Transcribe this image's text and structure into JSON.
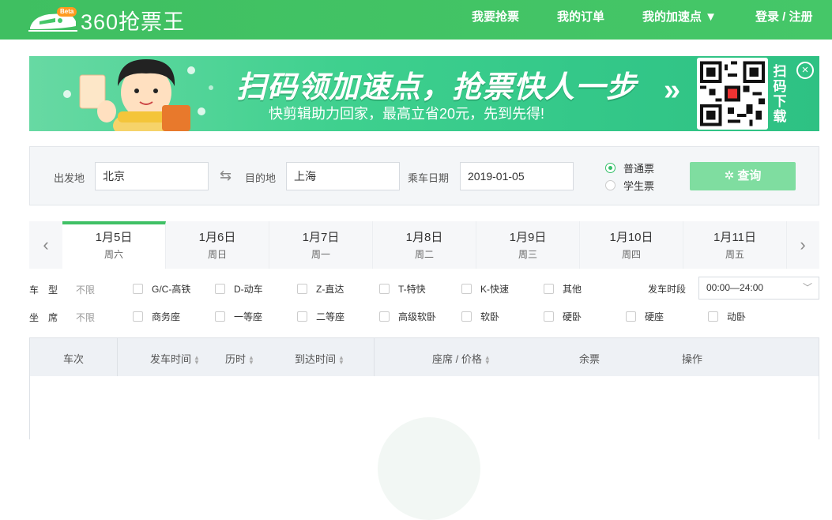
{
  "header": {
    "logo_badge": "Beta",
    "logo_text": "360抢票王",
    "nav": {
      "grab": "我要抢票",
      "orders": "我的订单",
      "boost": "我的加速点 ▼",
      "login": "登录 / 注册"
    }
  },
  "banner": {
    "title": "扫码领加速点，抢票快人一步",
    "subtitle": "快剪辑助力回家，最高立省20元，先到先得!",
    "arrow": "»",
    "qr_text": "扫码下载",
    "close": "×"
  },
  "search": {
    "from_label": "出发地",
    "from_value": "北京",
    "swap_icon": "⇆",
    "to_label": "目的地",
    "to_value": "上海",
    "date_label": "乘车日期",
    "date_value": "2019-01-05",
    "ticket_normal": "普通票",
    "ticket_student": "学生票",
    "query_button": "✲ 查询"
  },
  "dates": {
    "prev": "‹",
    "next": "›",
    "tabs": [
      {
        "date": "1月5日",
        "weekday": "周六"
      },
      {
        "date": "1月6日",
        "weekday": "周日"
      },
      {
        "date": "1月7日",
        "weekday": "周一"
      },
      {
        "date": "1月8日",
        "weekday": "周二"
      },
      {
        "date": "1月9日",
        "weekday": "周三"
      },
      {
        "date": "1月10日",
        "weekday": "周四"
      },
      {
        "date": "1月11日",
        "weekday": "周五"
      }
    ]
  },
  "filters": {
    "train_type_label": "车　型",
    "seat_label": "坐　席",
    "any": "不限",
    "train_types": [
      "G/C-高铁",
      "D-动车",
      "Z-直达",
      "T-特快",
      "K-快速",
      "其他"
    ],
    "seats": [
      "商务座",
      "一等座",
      "二等座",
      "高级软卧",
      "软卧",
      "硬卧",
      "硬座",
      "动卧"
    ],
    "time_label": "发车时段",
    "time_value": "00:00—24:00",
    "chevron": "﹀"
  },
  "table": {
    "headers": {
      "train_no": "车次",
      "depart": "发车时间",
      "duration": "历时",
      "arrive": "到达时间",
      "seat_price": "座席 / 价格",
      "remaining": "余票",
      "action": "操作"
    }
  },
  "colors": {
    "brand_green": "#3fbf61",
    "query_button": "#7fdda0"
  }
}
